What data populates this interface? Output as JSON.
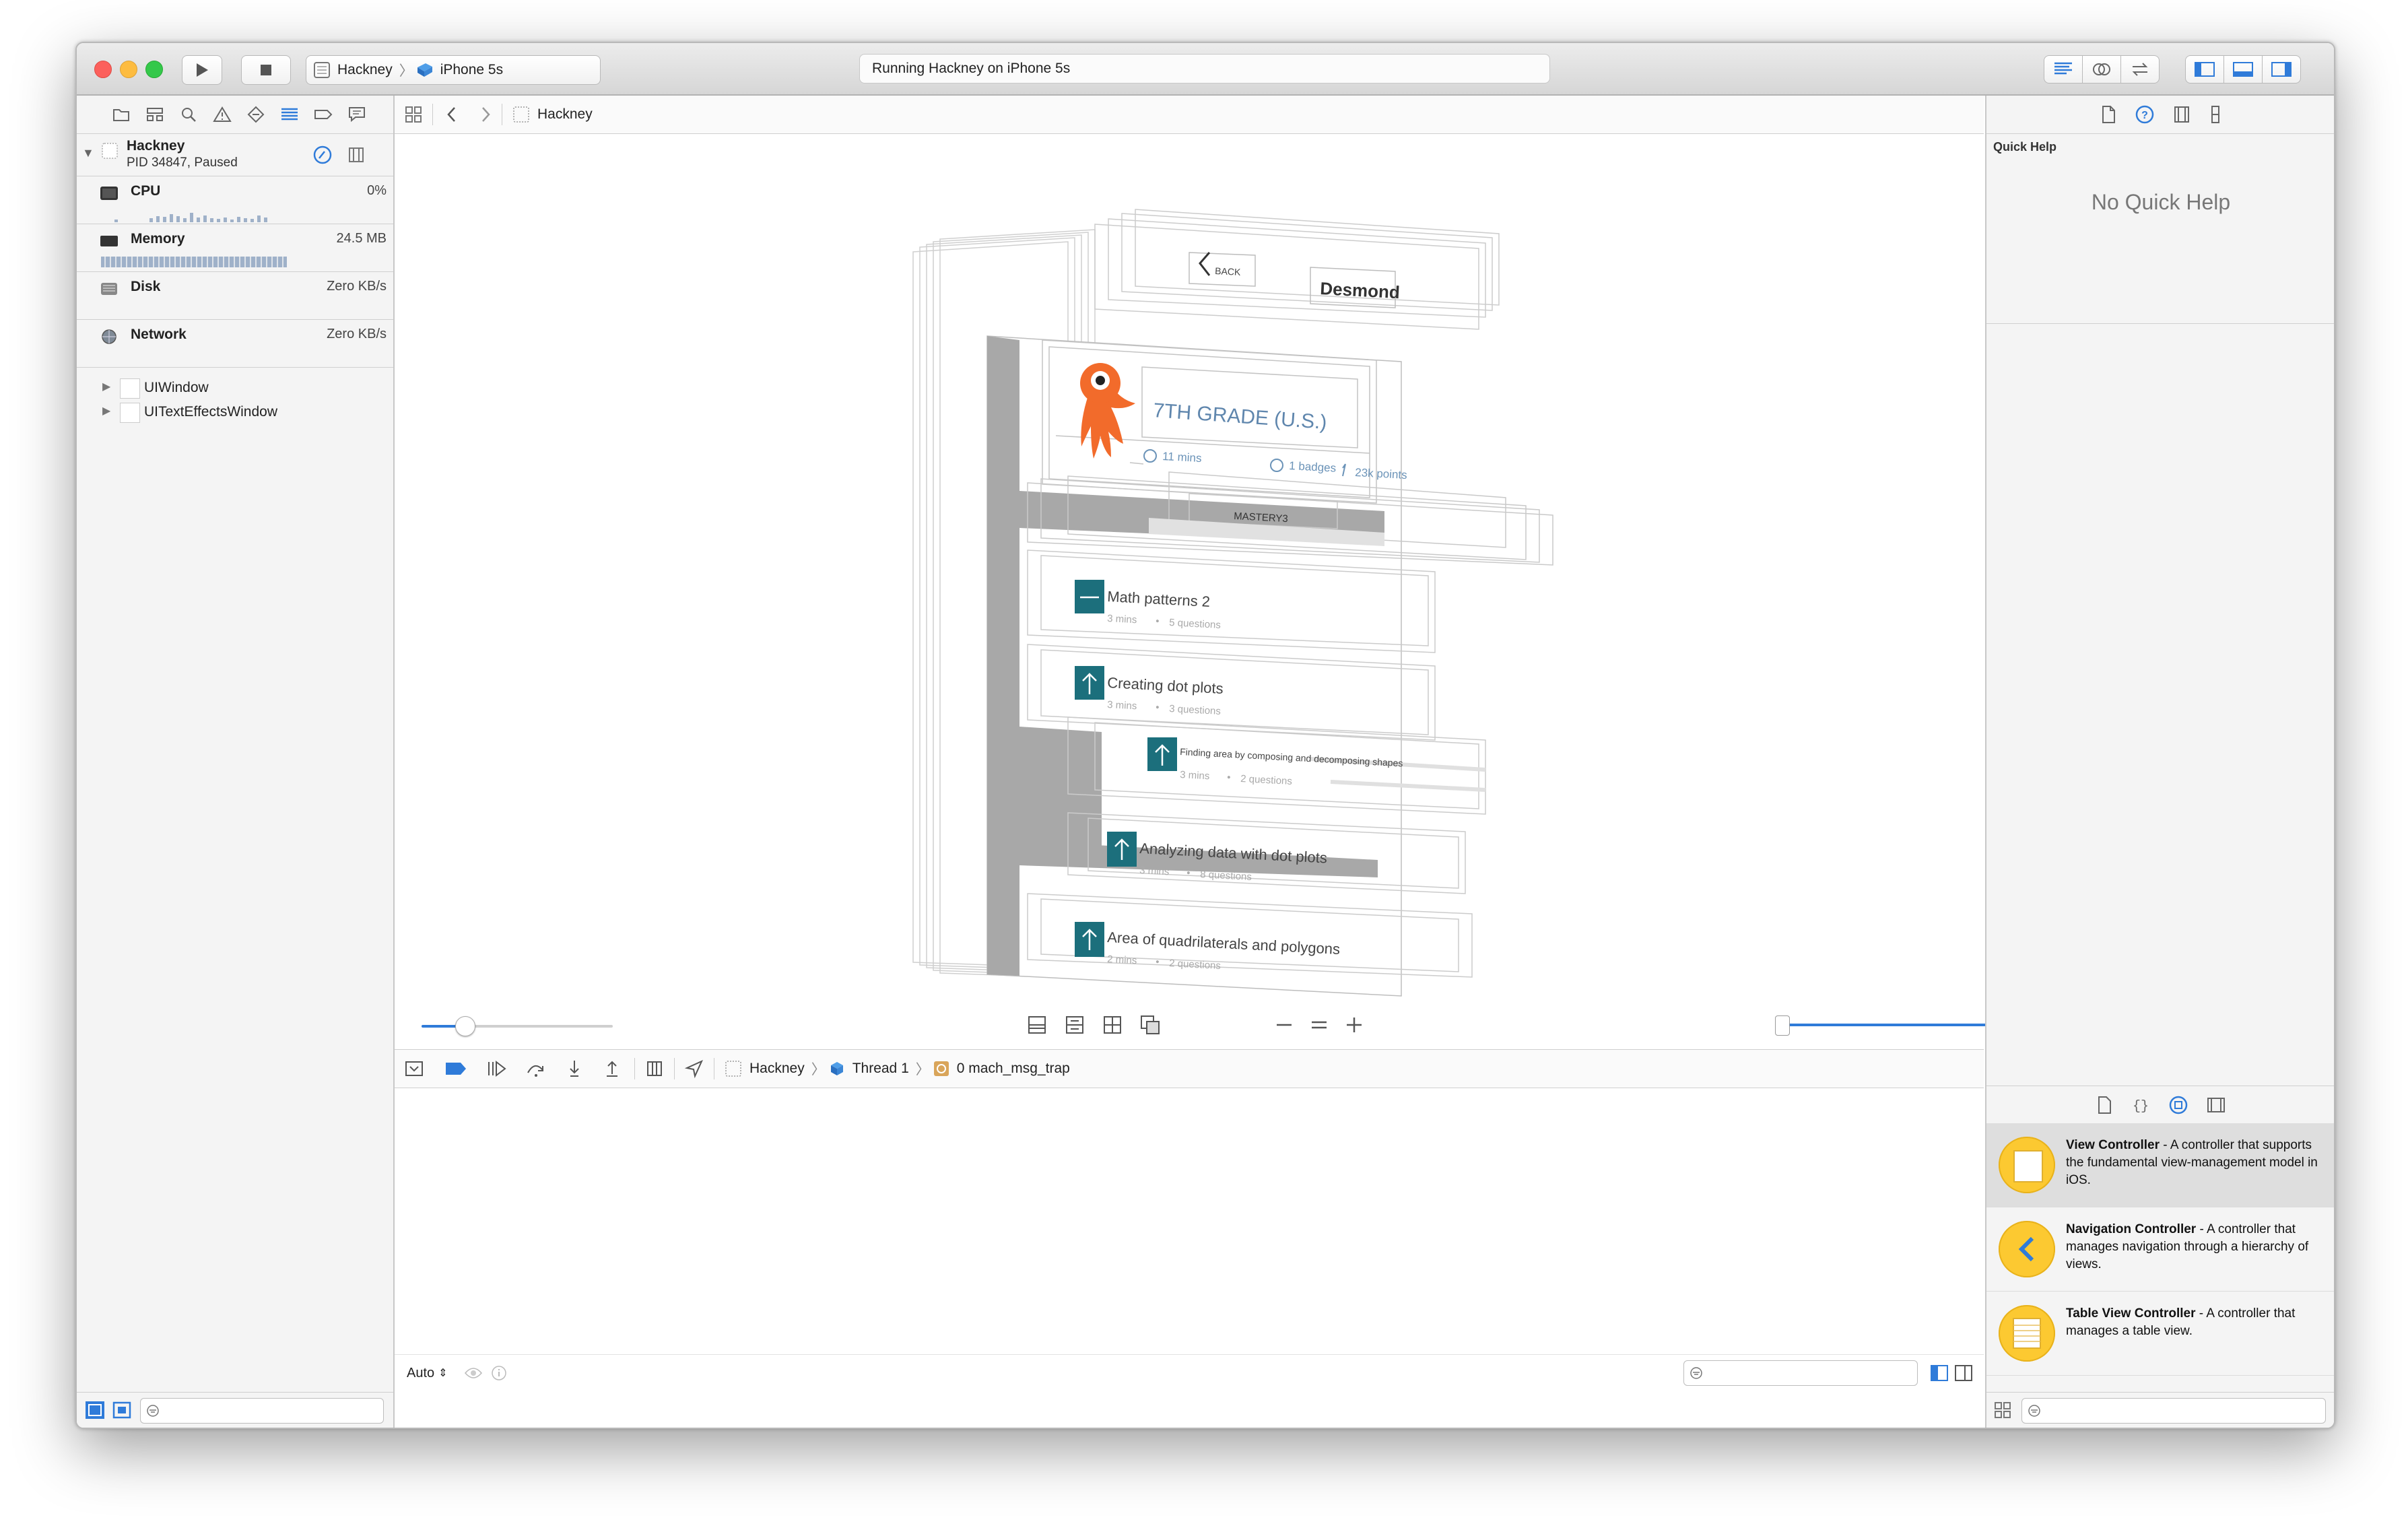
{
  "toolbar": {
    "scheme_target": "Hackney",
    "scheme_device": "iPhone 5s",
    "activity_status": "Running Hackney on iPhone 5s"
  },
  "navigator": {
    "process_name": "Hackney",
    "process_detail": "PID 34847, Paused",
    "gauges": [
      {
        "name": "CPU",
        "value": "0%"
      },
      {
        "name": "Memory",
        "value": "24.5 MB"
      },
      {
        "name": "Disk",
        "value": "Zero KB/s"
      },
      {
        "name": "Network",
        "value": "Zero KB/s"
      }
    ],
    "tree": [
      {
        "label": "UIWindow"
      },
      {
        "label": "UITextEffectsWindow"
      }
    ]
  },
  "editor": {
    "jump_item": "Hackney"
  },
  "hierarchy": {
    "back_label": "BACK",
    "nav_title": "Desmond",
    "grade_title": "7TH GRADE (U.S.)",
    "stat_mins": "11 mins",
    "stat_badges": "1 badges",
    "stat_points": "23k points",
    "mastery_label": "MASTERY3",
    "lessons": [
      {
        "title": "Math patterns 2",
        "mins": "3 mins",
        "questions": "5 questions"
      },
      {
        "title": "Creating dot plots",
        "mins": "3 mins",
        "questions": "3 questions"
      },
      {
        "title": "Finding area by composing and decomposing shapes",
        "mins": "3 mins",
        "questions": "2 questions"
      },
      {
        "title": "Analyzing data with dot plots",
        "mins": "3 mins",
        "questions": "8 questions"
      },
      {
        "title": "Area of quadrilaterals and polygons",
        "mins": "2 mins",
        "questions": "2 questions"
      }
    ],
    "dot_separator": "•"
  },
  "debug": {
    "crumb_process": "Hackney",
    "crumb_thread": "Thread 1",
    "crumb_frame": "0 mach_msg_trap",
    "console_mode": "Auto"
  },
  "inspector": {
    "quick_help_title": "Quick Help",
    "no_quick_help": "No Quick Help",
    "library": [
      {
        "name": "View Controller",
        "desc": " - A controller that supports the fundamental view-management model in iOS."
      },
      {
        "name": "Navigation Controller",
        "desc": " - A controller that manages navigation through a hierarchy of views."
      },
      {
        "name": "Table View Controller",
        "desc": " - A controller that manages a table view."
      }
    ]
  },
  "colors": {
    "accent": "#2f7bd9",
    "lesson_icon": "#1c6f7c",
    "library_icon": "#fcc931"
  }
}
